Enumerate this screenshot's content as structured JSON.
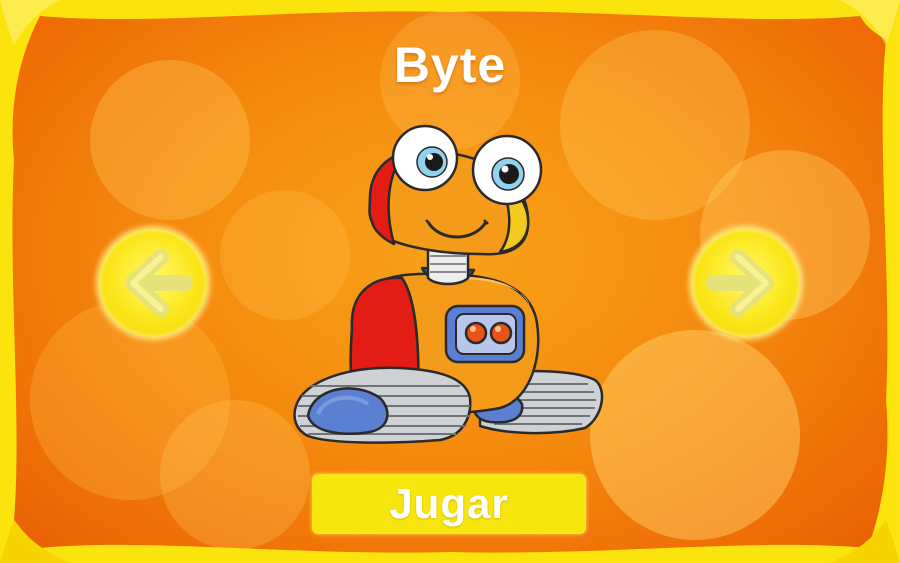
{
  "character": {
    "name": "Byte",
    "image": "robot-character"
  },
  "navigation": {
    "prev_icon": "arrow-left-icon",
    "next_icon": "arrow-right-icon"
  },
  "actions": {
    "play_label": "Jugar"
  },
  "colors": {
    "background": "#f58a0e",
    "frame": "#fbe30e",
    "button": "#f7e60d",
    "text": "#ffffff"
  }
}
